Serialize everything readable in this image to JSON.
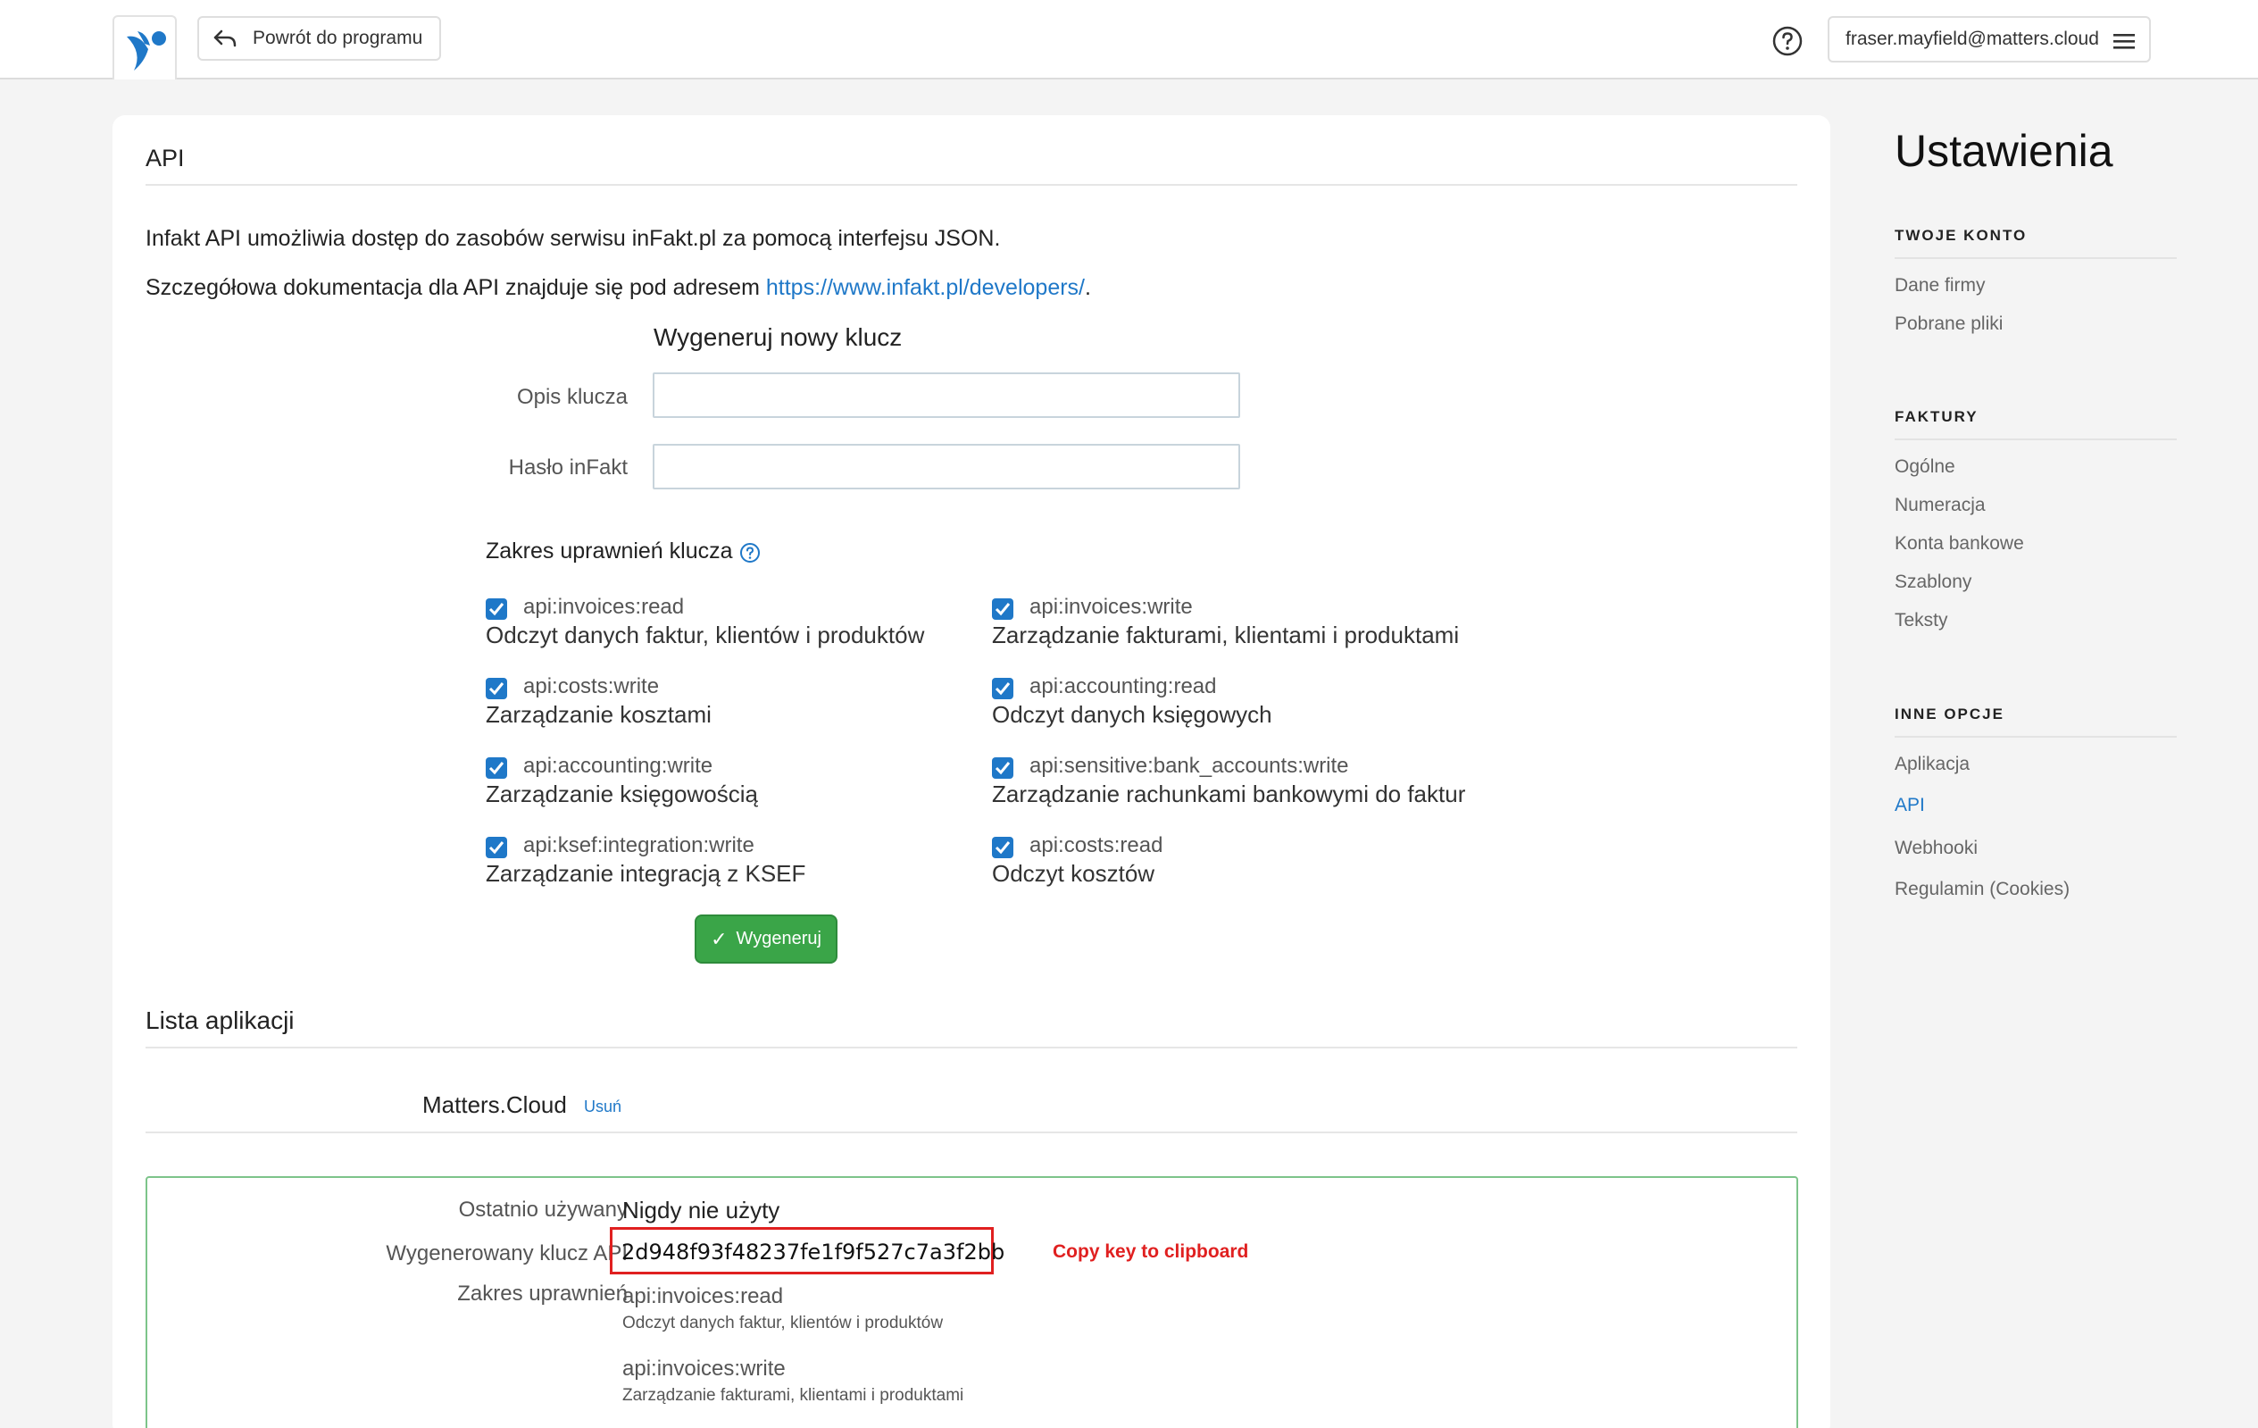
{
  "header": {
    "back_label": "Powrót do programu",
    "user_email": "fraser.mayfield@matters.cloud"
  },
  "api": {
    "heading": "API",
    "intro": "Infakt API umożliwia dostęp do zasobów serwisu inFakt.pl za pomocą interfejsu JSON.",
    "docs_prefix": "Szczegółowa dokumentacja dla API znajduje się pod adresem ",
    "docs_link": "https://www.infakt.pl/developers/",
    "docs_suffix": "."
  },
  "generate": {
    "title": "Wygeneruj nowy klucz",
    "description_label": "Opis klucza",
    "description_value": "",
    "password_label": "Hasło inFakt",
    "password_value": "",
    "scope_title": "Zakres uprawnień klucza",
    "permissions": [
      {
        "code": "api:invoices:read",
        "desc": "Odczyt danych faktur, klientów i produktów",
        "checked": true
      },
      {
        "code": "api:invoices:write",
        "desc": "Zarządzanie fakturami, klientami i produktami",
        "checked": true
      },
      {
        "code": "api:costs:write",
        "desc": "Zarządzanie kosztami",
        "checked": true
      },
      {
        "code": "api:accounting:read",
        "desc": "Odczyt danych księgowych",
        "checked": true
      },
      {
        "code": "api:accounting:write",
        "desc": "Zarządzanie księgowością",
        "checked": true
      },
      {
        "code": "api:sensitive:bank_accounts:write",
        "desc": "Zarządzanie rachunkami bankowymi do faktur",
        "checked": true
      },
      {
        "code": "api:ksef:integration:write",
        "desc": "Zarządzanie integracją z KSEF",
        "checked": true
      },
      {
        "code": "api:costs:read",
        "desc": "Odczyt kosztów",
        "checked": true
      }
    ],
    "button_label": "Wygeneruj"
  },
  "apps": {
    "heading": "Lista aplikacji",
    "app_name": "Matters.Cloud",
    "delete_label": "Usuń",
    "last_used_label": "Ostatnio używany",
    "last_used_value": "Nigdy nie użyty",
    "key_label": "Wygenerowany klucz API",
    "key_value": "2d948f93f48237fe1f9f527c7a3f2bb",
    "copy_note": "Copy key to clipboard",
    "scope_label": "Zakres uprawnień",
    "scopes": [
      {
        "code": "api:invoices:read",
        "desc": "Odczyt danych faktur, klientów i produktów"
      },
      {
        "code": "api:invoices:write",
        "desc": "Zarządzanie fakturami, klientami i produktami"
      }
    ]
  },
  "sidebar": {
    "title": "Ustawienia",
    "sections": [
      {
        "title": "TWOJE KONTO",
        "items": [
          "Dane firmy",
          "Pobrane pliki"
        ]
      },
      {
        "title": "FAKTURY",
        "items": [
          "Ogólne",
          "Numeracja",
          "Konta bankowe",
          "Szablony",
          "Teksty"
        ]
      },
      {
        "title": "INNE OPCJE",
        "items": [
          "Aplikacja",
          "API",
          "Webhooki",
          "Regulamin (Cookies)"
        ]
      }
    ],
    "active_item": "API"
  },
  "colors": {
    "accent": "#1f78c8",
    "success": "#3aa548",
    "highlight": "#e02020"
  }
}
